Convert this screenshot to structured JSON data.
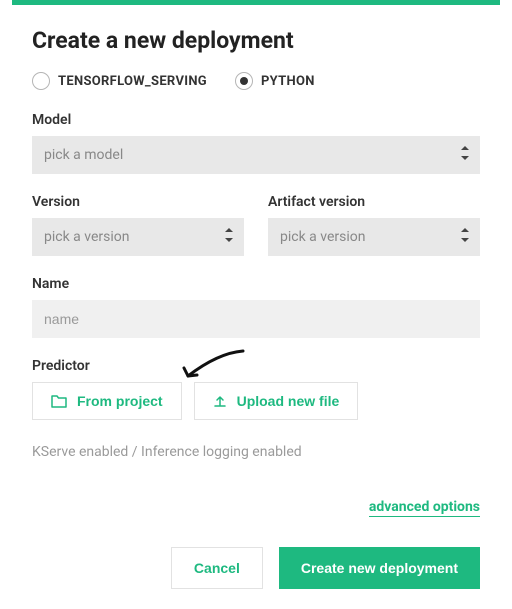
{
  "title": "Create a new deployment",
  "radios": {
    "tensorflow": "TENSORFLOW_SERVING",
    "python": "PYTHON",
    "selected": "python"
  },
  "fields": {
    "model": {
      "label": "Model",
      "placeholder": "pick a model"
    },
    "version": {
      "label": "Version",
      "placeholder": "pick a version"
    },
    "artifact_version": {
      "label": "Artifact version",
      "placeholder": "pick a version"
    },
    "name": {
      "label": "Name",
      "placeholder": "name"
    },
    "predictor": {
      "label": "Predictor"
    }
  },
  "predictor_buttons": {
    "from_project": "From project",
    "upload": "Upload new file"
  },
  "status_text": "KServe enabled / Inference logging enabled",
  "advanced_link": "advanced options",
  "footer": {
    "cancel": "Cancel",
    "create": "Create new deployment"
  },
  "colors": {
    "accent": "#1eb980"
  }
}
